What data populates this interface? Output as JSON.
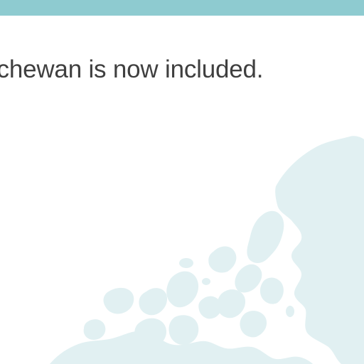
{
  "message": {
    "text": "tchewan is now included."
  },
  "theme": {
    "top_bar_color": "#8ecbd0",
    "map_color": "#e1f0f2",
    "text_color": "#3f3f3f"
  },
  "decor": {
    "background_icon": "canada-map-watermark"
  }
}
